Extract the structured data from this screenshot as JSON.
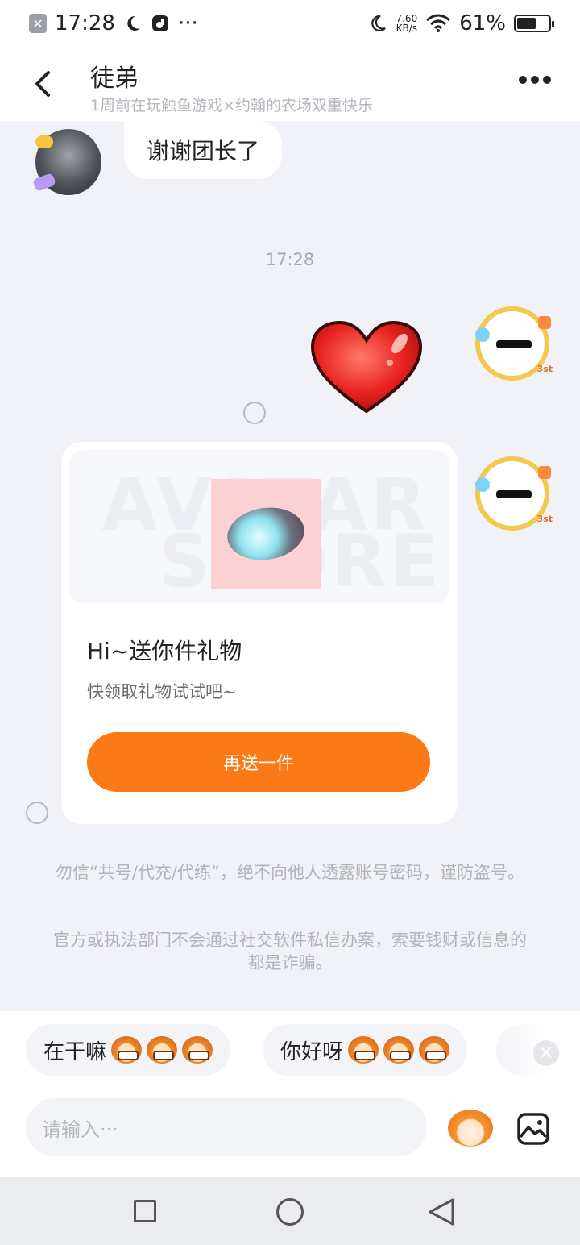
{
  "status_bar": {
    "time": "17:28",
    "more_indicator": "···",
    "net_speed_value": "7.60",
    "net_speed_unit": "KB/s",
    "battery": "61%",
    "battery_level": 0.61,
    "icons": [
      "notification-x-icon",
      "moon-icon",
      "music-app-icon",
      "wifi-icon",
      "battery-icon"
    ]
  },
  "header": {
    "title": "徒弟",
    "subtitle": "1周前在玩触鱼游戏×约翰的农场双重快乐",
    "back_icon": "back-chevron-icon",
    "more_icon": "more-dots-icon"
  },
  "chat": {
    "messages": [
      {
        "side": "left",
        "type": "text",
        "text": "谢谢团长了"
      },
      {
        "type": "time",
        "text": "17:28"
      },
      {
        "side": "right",
        "type": "sticker",
        "sticker": "red-heart"
      },
      {
        "side": "right",
        "type": "gift",
        "watermark_top": "AVATAR",
        "watermark_bottom": "STORE",
        "title": "Hi~送你件礼物",
        "desc": "快领取礼物试试吧~",
        "button": "再送一件"
      }
    ]
  },
  "notices": [
    "勿信“共号/代充/代练”，绝不向他人透露账号密码，谨防盗号。",
    "官方或执法部门不会通过社交软件私信办案，索要钱财或信息的都是诈骗。"
  ],
  "quick_replies": [
    {
      "text": "在干嘛"
    },
    {
      "text": "你好呀"
    }
  ],
  "input": {
    "placeholder": "请输入···"
  },
  "colors": {
    "accent": "#fb7a16",
    "background": "#f1f2f7",
    "bubble": "#ffffff",
    "hint_text": "#b2b4ba"
  }
}
